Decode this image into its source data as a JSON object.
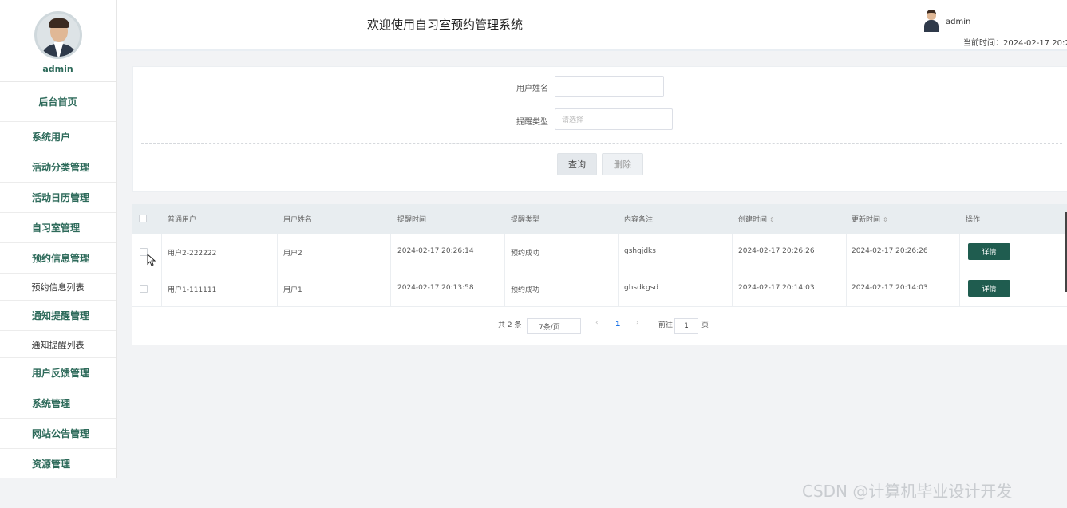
{
  "sidebar": {
    "username": "admin",
    "items": [
      {
        "label": "后台首页"
      },
      {
        "label": "系统用户"
      },
      {
        "label": "活动分类管理"
      },
      {
        "label": "活动日历管理"
      },
      {
        "label": "自习室管理"
      },
      {
        "label": "预约信息管理"
      },
      {
        "label": "预约信息列表"
      },
      {
        "label": "通知提醒管理"
      },
      {
        "label": "通知提醒列表"
      },
      {
        "label": "用户反馈管理"
      },
      {
        "label": "系统管理"
      },
      {
        "label": "网站公告管理"
      },
      {
        "label": "资源管理"
      }
    ]
  },
  "header": {
    "title": "欢迎使用自习室预约管理系统",
    "user": "admin",
    "time": "当前时间：2024-02-17 20:2"
  },
  "search": {
    "name_label": "用户姓名",
    "name_value": "",
    "type_label": "提醒类型",
    "type_placeholder": "请选择",
    "query_button": "查询",
    "delete_button": "删除"
  },
  "table": {
    "headers": [
      "普通用户",
      "用户姓名",
      "提醒时间",
      "提醒类型",
      "内容备注",
      "创建时间",
      "更新时间",
      "操作"
    ],
    "sort_icon": "⇕",
    "rows": [
      {
        "user": "用户2-222222",
        "name": "用户2",
        "remind_time": "2024-02-17 20:26:14",
        "type": "预约成功",
        "note": "gshgjdks",
        "created": "2024-02-17 20:26:26",
        "updated": "2024-02-17 20:26:26",
        "action": "详情"
      },
      {
        "user": "用户1-111111",
        "name": "用户1",
        "remind_time": "2024-02-17 20:13:58",
        "type": "预约成功",
        "note": "ghsdkgsd",
        "created": "2024-02-17 20:14:03",
        "updated": "2024-02-17 20:14:03",
        "action": "详情"
      }
    ]
  },
  "pagination": {
    "total": "共 2 条",
    "page_size": "7条/页",
    "prev": "‹",
    "current": "1",
    "next": "›",
    "goto_label": "前往",
    "goto_value": "1",
    "page_suffix": "页"
  },
  "watermark": "CSDN @计算机毕业设计开发",
  "colors": {
    "accent": "#2d6a5a",
    "button_dark": "#1f5c4f",
    "header_bg": "#e8edf0"
  }
}
